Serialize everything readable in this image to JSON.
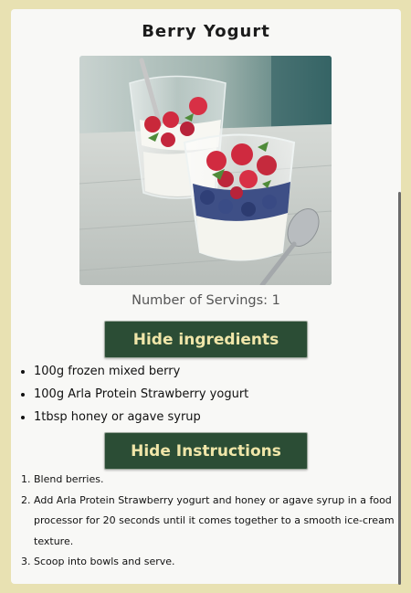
{
  "recipe": {
    "title": "Berry Yogurt",
    "photo_alt": "Berry yogurt dessert in glasses with raspberries and blueberries",
    "servings_text": "Number of Servings: 1"
  },
  "buttons": {
    "hide_ingredients": "Hide ingredients",
    "hide_instructions": "Hide Instructions"
  },
  "ingredients": [
    "100g frozen mixed berry",
    "100g Arla Protein Strawberry yogurt",
    "1tbsp honey or agave syrup"
  ],
  "instructions": [
    "Blend berries.",
    "Add Arla Protein Strawberry yogurt and honey or agave syrup in a food processor for 20 seconds until it comes together to a smooth ice-cream texture.",
    "Scoop into bowls and serve."
  ],
  "colors": {
    "page_background": "#e8e1b2",
    "card_background": "#f8f8f6",
    "button_background": "#2b4d35",
    "button_text": "#f0e6a9"
  }
}
